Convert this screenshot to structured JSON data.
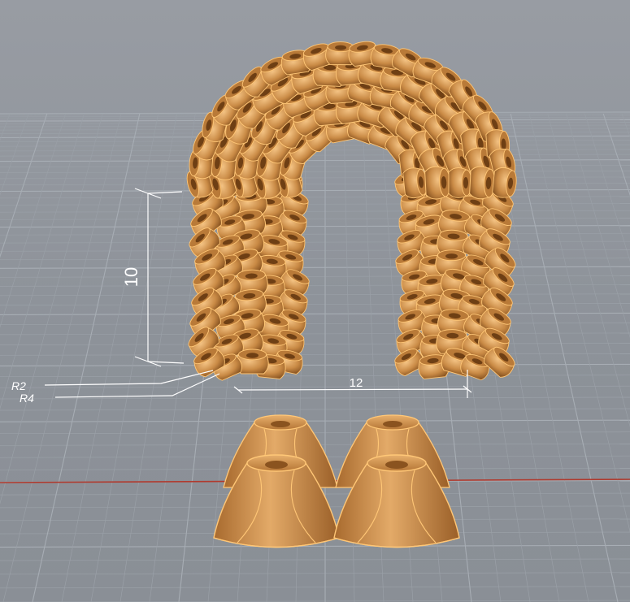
{
  "viewport": {
    "label": "3D viewport"
  },
  "colors": {
    "background": "#8f949b",
    "grid_minor": "#9aa0a7",
    "grid_major": "#a7adb4",
    "axis_x": "#b03a2e",
    "material": "#c98a45",
    "material_dark": "#7d4a1a",
    "material_light": "#e9b574",
    "edge_highlight": "#ffc777",
    "dimension": "#ffffff"
  },
  "dimensions": {
    "height_value": "10",
    "width_value": "12",
    "radius_inner_label": "R2",
    "radius_outer_label": "R4"
  },
  "objects": {
    "arch": "horseshoe-arch-of-cone-modules",
    "modules": "four-cone-modules"
  }
}
